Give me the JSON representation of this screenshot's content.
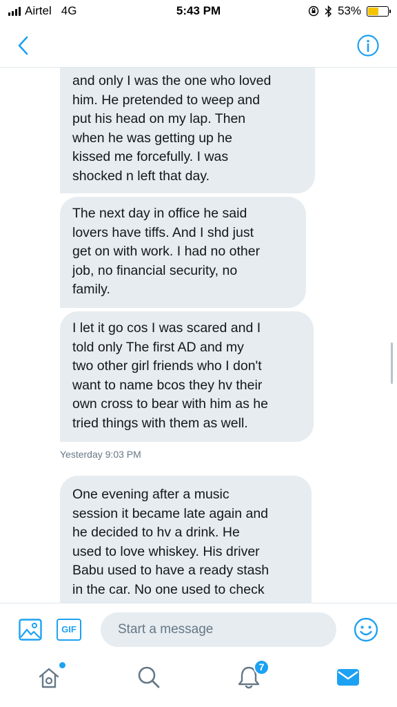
{
  "status_bar": {
    "carrier": "Airtel",
    "network": "4G",
    "time": "5:43 PM",
    "battery_percent_label": "53%",
    "battery_level": 0.53,
    "icons": [
      "signal-icon",
      "orientation-lock-icon",
      "bluetooth-icon",
      "battery-icon"
    ]
  },
  "header": {
    "back_icon": "chevron-left-icon",
    "info_icon": "info-icon",
    "accent_color": "#1da1f2"
  },
  "messages": [
    {
      "text": "and only I was the one who loved\nhim. He pretended to weep and\nput his head on my lap. Then\nwhen he was getting up he\nkissed me forcefully. I was\nshocked n left that day."
    },
    {
      "text": "The next day in office he said\nlovers have tiffs. And I shd just\nget on with work. I had no other\njob, no financial security, no\nfamily."
    },
    {
      "text": "I let it go cos I was scared and I\ntold only The first AD and my\ntwo other girl friends who I don't\nwant to name bcos they hv their\nown cross to bear with him as he\ntried things with them as well."
    },
    {
      "text": "One evening after a music\nsession it became late again and\nhe decided to hv a drink. He\nused to love whiskey. His driver\nBabu used to have a ready stash\nin the car. No one used to check"
    }
  ],
  "timestamp": "Yesterday 9:03 PM",
  "composer": {
    "placeholder": "Start a message",
    "gif_label": "GIF",
    "image_icon": "image-icon",
    "emoji_icon": "emoji-icon"
  },
  "tabbar": {
    "items": [
      {
        "name": "home",
        "icon": "home-icon"
      },
      {
        "name": "search",
        "icon": "search-icon"
      },
      {
        "name": "notifications",
        "icon": "bell-icon",
        "badge": "7"
      },
      {
        "name": "messages",
        "icon": "mail-icon"
      }
    ]
  },
  "colors": {
    "bubble": "#e6ecf0",
    "text": "#14171a",
    "muted": "#657786",
    "accent": "#1da1f2"
  }
}
